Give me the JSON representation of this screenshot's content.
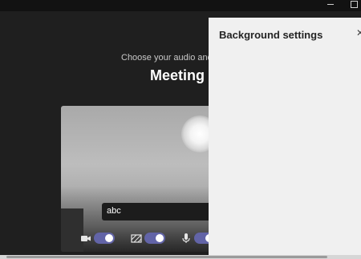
{
  "window": {
    "minimize_icon": "minimize-icon",
    "maximize_icon": "maximize-icon"
  },
  "main": {
    "subtitle": "Choose your audio and vi",
    "title": "Meeting n",
    "name_input_value": "abc"
  },
  "controls": {
    "camera_icon": "video-camera-icon",
    "camera_on": true,
    "background_icon": "background-effects-icon",
    "background_on": true,
    "mic_icon": "microphone-icon",
    "mic_on": true,
    "accent_color": "#6264a7"
  },
  "panel": {
    "title": "Background settings",
    "close_icon": "close-icon"
  }
}
